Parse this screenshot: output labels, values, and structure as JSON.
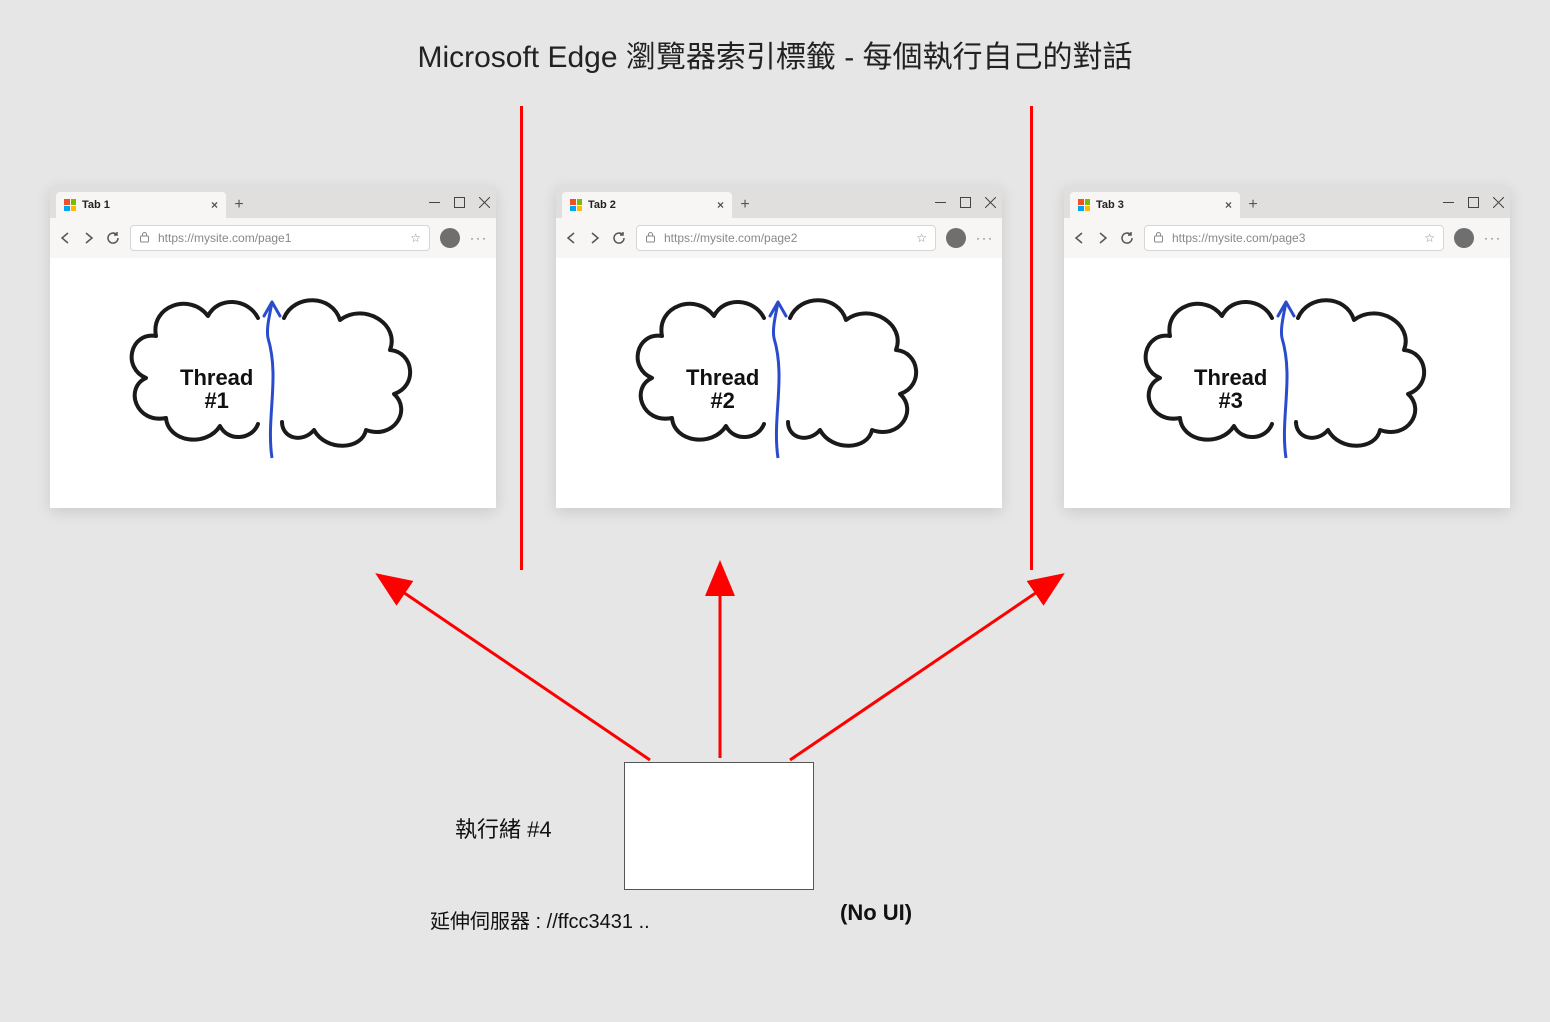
{
  "title": "Microsoft Edge 瀏覽器索引標籤 -    每個執行自己的對話",
  "browsers": [
    {
      "tab": "Tab 1",
      "url": "https://mysite.com/page1",
      "thread": "Thread\n#1"
    },
    {
      "tab": "Tab 2",
      "url": "https://mysite.com/page2",
      "thread": "Thread\n#2"
    },
    {
      "tab": "Tab 3",
      "url": "https://mysite.com/page3",
      "thread": "Thread\n#3"
    }
  ],
  "thread4_label": "執行緒 #4",
  "server_label": "延伸伺服器 : //ffcc3431 ..",
  "no_ui_label": "(No UI)"
}
